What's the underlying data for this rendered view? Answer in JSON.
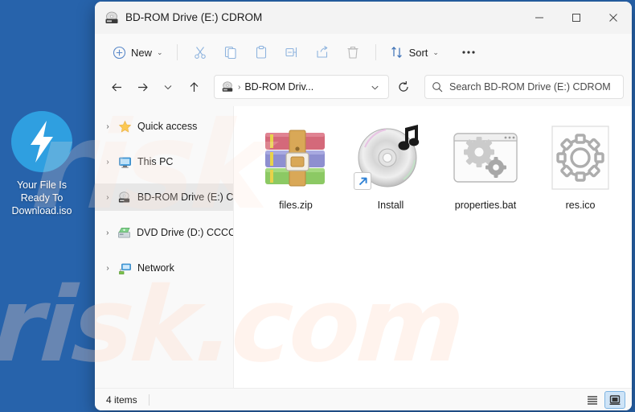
{
  "desktop": {
    "background_color": "#2763ab",
    "icon": {
      "name": "bolt-icon",
      "label_line1": "Your File Is",
      "label_line2": "Ready To",
      "label_line3": "Download.iso",
      "circle_color": "#2f9fe0"
    },
    "watermark_lower": "risk.com",
    "watermark_upper": "risk"
  },
  "window": {
    "title": "BD-ROM Drive (E:) CDROM",
    "title_icon": "cd-drive-icon",
    "controls": {
      "minimize": "─",
      "maximize": "□",
      "close": "✕"
    }
  },
  "toolbar": {
    "new_label": "New",
    "new_icon": "plus-circle-icon",
    "cut_icon": "scissors-icon",
    "copy_icon": "copy-icon",
    "paste_icon": "paste-icon",
    "rename_icon": "rename-icon",
    "share_icon": "share-icon",
    "delete_icon": "trash-icon",
    "sort_label": "Sort",
    "sort_icon": "sort-arrows-icon",
    "more_icon": "ellipsis-icon",
    "chevron": "⌄"
  },
  "navbar": {
    "back_icon": "arrow-left-icon",
    "forward_icon": "arrow-right-icon",
    "recent_icon": "chevron-down-icon",
    "up_icon": "arrow-up-icon",
    "address": {
      "drive_icon": "cd-drive-icon",
      "separator": "›",
      "text": "BD-ROM Driv...",
      "dropdown_icon": "chevron-down-icon"
    },
    "refresh_icon": "refresh-icon",
    "search": {
      "icon": "search-icon",
      "placeholder": "Search BD-ROM Drive (E:) CDROM",
      "value": ""
    }
  },
  "sidebar": {
    "items": [
      {
        "label": "Quick access",
        "icon": "star-icon",
        "selected": false
      },
      {
        "label": "This PC",
        "icon": "monitor-icon",
        "selected": false
      },
      {
        "label": "BD-ROM Drive (E:) C",
        "icon": "cd-drive-icon",
        "selected": true
      },
      {
        "label": "DVD Drive (D:) CCCC",
        "icon": "dvd-drive-icon",
        "selected": false
      },
      {
        "label": "Network",
        "icon": "network-icon",
        "selected": false
      }
    ],
    "expand_arrow": "›"
  },
  "files": [
    {
      "name": "files.zip",
      "icon": "archive-icon",
      "shortcut": false
    },
    {
      "name": "Install",
      "icon": "disc-music-icon",
      "shortcut": true
    },
    {
      "name": "properties.bat",
      "icon": "gears-window-icon",
      "shortcut": false
    },
    {
      "name": "res.ico",
      "icon": "gear-outline-icon",
      "shortcut": false
    }
  ],
  "statusbar": {
    "item_count": "4 items",
    "details_view_icon": "details-view-icon",
    "icons_view_icon": "large-icons-view-icon"
  }
}
